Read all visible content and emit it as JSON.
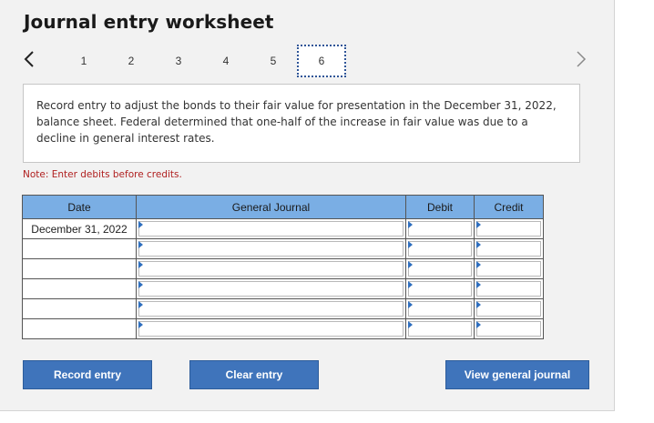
{
  "header": {
    "title": "Journal entry worksheet"
  },
  "nav": {
    "tabs": [
      {
        "label": "1",
        "active": false
      },
      {
        "label": "2",
        "active": false
      },
      {
        "label": "3",
        "active": false
      },
      {
        "label": "4",
        "active": false
      },
      {
        "label": "5",
        "active": false
      },
      {
        "label": "6",
        "active": true
      }
    ]
  },
  "instruction": {
    "text": "Record entry to adjust the bonds to their fair value for presentation in the December 31, 2022, balance sheet. Federal determined that one-half of the increase in fair value was due to a decline in general interest rates."
  },
  "note": "Note: Enter debits before credits.",
  "table": {
    "headers": {
      "date": "Date",
      "journal": "General Journal",
      "debit": "Debit",
      "credit": "Credit"
    },
    "rows": [
      {
        "date": "December 31, 2022"
      },
      {
        "date": ""
      },
      {
        "date": ""
      },
      {
        "date": ""
      },
      {
        "date": ""
      },
      {
        "date": ""
      }
    ]
  },
  "buttons": {
    "record": "Record entry",
    "clear": "Clear entry",
    "view": "View general journal"
  },
  "colors": {
    "header_bg": "#7aaee4",
    "button_bg": "#3f74bb",
    "note_text": "#b02020",
    "active_tab_border": "#2f5597"
  }
}
